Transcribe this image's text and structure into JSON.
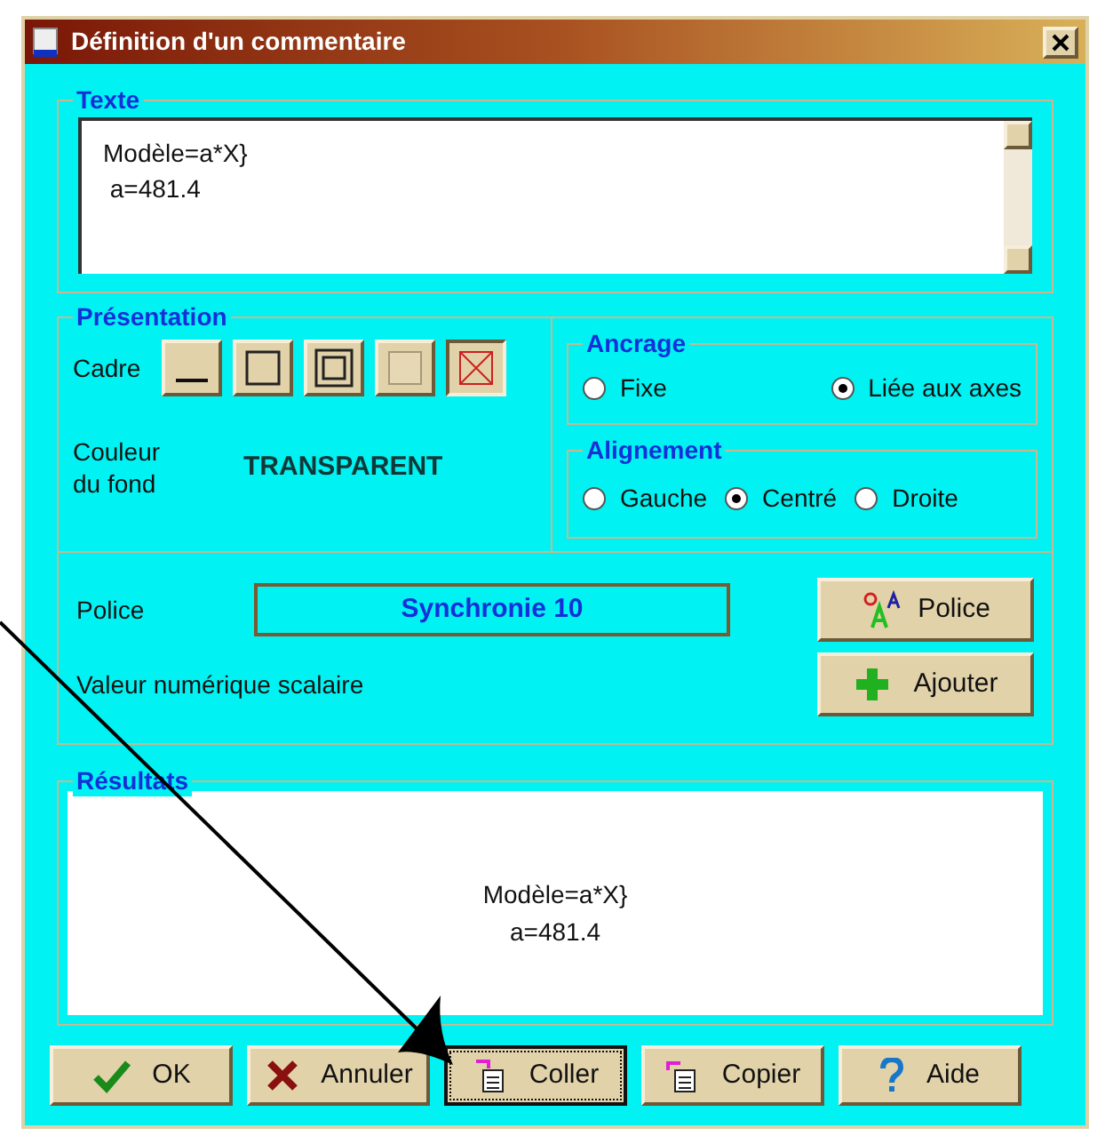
{
  "window": {
    "title": "Définition d'un commentaire"
  },
  "texte": {
    "label": "Texte",
    "lines": [
      "Modèle=a*X}",
      " a=481.4"
    ]
  },
  "presentation": {
    "label": "Présentation",
    "cadre": {
      "label": "Cadre",
      "options": [
        {
          "kind": "underline",
          "selected": false
        },
        {
          "kind": "single",
          "selected": false
        },
        {
          "kind": "double",
          "selected": false
        },
        {
          "kind": "raised",
          "selected": false
        },
        {
          "kind": "none",
          "selected": true
        }
      ]
    },
    "fond": {
      "label_lines": [
        "Couleur",
        "du fond"
      ],
      "value": "TRANSPARENT"
    },
    "ancrage": {
      "label": "Ancrage",
      "options": [
        {
          "label": "Fixe",
          "selected": false
        },
        {
          "label": "Liée aux axes",
          "selected": true
        }
      ]
    },
    "alignement": {
      "label": "Alignement",
      "options": [
        {
          "label": "Gauche",
          "selected": false
        },
        {
          "label": "Centré",
          "selected": true
        },
        {
          "label": "Droite",
          "selected": false
        }
      ]
    },
    "police": {
      "label": "Police",
      "value": "Synchronie  10",
      "button": "Police"
    },
    "valeur": {
      "label": "Valeur numérique scalaire",
      "button": "Ajouter"
    }
  },
  "resultats": {
    "label": "Résultats",
    "lines": [
      "Modèle=a*X}",
      "a=481.4"
    ]
  },
  "buttons": [
    {
      "kind": "ok",
      "label": "OK",
      "focused": false
    },
    {
      "kind": "cancel",
      "label": "Annuler",
      "focused": false
    },
    {
      "kind": "paste",
      "label": "Coller",
      "focused": true
    },
    {
      "kind": "copy",
      "label": "Copier",
      "focused": false
    },
    {
      "kind": "help",
      "label": "Aide",
      "focused": false
    }
  ]
}
